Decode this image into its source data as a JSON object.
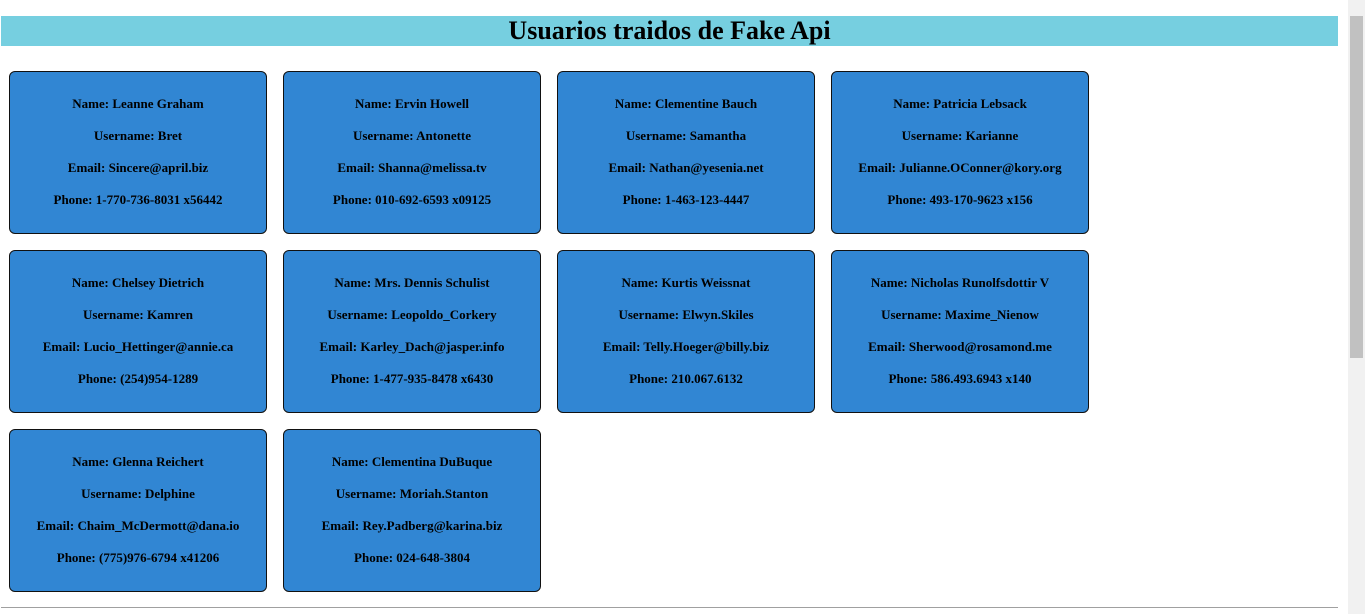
{
  "header": {
    "title": "Usuarios traidos de Fake Api"
  },
  "labels": {
    "name": "Name:",
    "username": "Username:",
    "email": "Email:",
    "phone": "Phone:"
  },
  "users": [
    {
      "name": "Leanne Graham",
      "username": "Bret",
      "email": "Sincere@april.biz",
      "phone": "1-770-736-8031 x56442"
    },
    {
      "name": "Ervin Howell",
      "username": "Antonette",
      "email": "Shanna@melissa.tv",
      "phone": "010-692-6593 x09125"
    },
    {
      "name": "Clementine Bauch",
      "username": "Samantha",
      "email": "Nathan@yesenia.net",
      "phone": "1-463-123-4447"
    },
    {
      "name": "Patricia Lebsack",
      "username": "Karianne",
      "email": "Julianne.OConner@kory.org",
      "phone": "493-170-9623 x156"
    },
    {
      "name": "Chelsey Dietrich",
      "username": "Kamren",
      "email": "Lucio_Hettinger@annie.ca",
      "phone": "(254)954-1289"
    },
    {
      "name": "Mrs. Dennis Schulist",
      "username": "Leopoldo_Corkery",
      "email": "Karley_Dach@jasper.info",
      "phone": "1-477-935-8478 x6430"
    },
    {
      "name": "Kurtis Weissnat",
      "username": "Elwyn.Skiles",
      "email": "Telly.Hoeger@billy.biz",
      "phone": "210.067.6132"
    },
    {
      "name": "Nicholas Runolfsdottir V",
      "username": "Maxime_Nienow",
      "email": "Sherwood@rosamond.me",
      "phone": "586.493.6943 x140"
    },
    {
      "name": "Glenna Reichert",
      "username": "Delphine",
      "email": "Chaim_McDermott@dana.io",
      "phone": "(775)976-6794 x41206"
    },
    {
      "name": "Clementina DuBuque",
      "username": "Moriah.Stanton",
      "email": "Rey.Padberg@karina.biz",
      "phone": "024-648-3804"
    }
  ],
  "colors": {
    "header_bg": "#76cfe0",
    "card_bg": "#3186d3"
  }
}
